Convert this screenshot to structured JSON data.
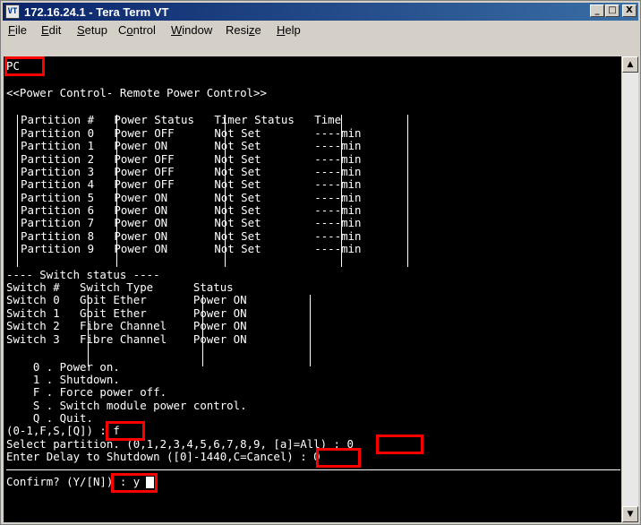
{
  "window": {
    "icon_label": "VT",
    "title": "172.16.24.1 - Tera Term VT",
    "controls": {
      "minimize": "_",
      "maximize": "□",
      "close": "X"
    }
  },
  "menu": [
    "File",
    "Edit",
    "Setup",
    "Control",
    "Window",
    "Resize",
    "Help"
  ],
  "menu_underline": [
    "F",
    "E",
    "S",
    "o",
    "W",
    "z",
    "H"
  ],
  "terminal": {
    "lines": [
      "PC",
      "<<Power Control- Remote Power Control>>",
      "Partition #   Power Status   Timer Status   Time",
      "Partition 0   Power OFF      Not Set        ----min",
      "Partition 1   Power ON       Not Set        ----min",
      "Partition 2   Power OFF      Not Set        ----min",
      "Partition 3   Power OFF      Not Set        ----min",
      "Partition 4   Power OFF      Not Set        ----min",
      "Partition 5   Power ON       Not Set        ----min",
      "Partition 6   Power ON       Not Set        ----min",
      "Partition 7   Power ON       Not Set        ----min",
      "Partition 8   Power ON       Not Set        ----min",
      "Partition 9   Power ON       Not Set        ----min",
      "---- Switch status ----",
      "Switch #   Switch Type      Status",
      "Switch 0   Gbit Ether       Power ON",
      "Switch 1   Gbit Ether       Power ON",
      "Switch 2   Fibre Channel    Power ON",
      "Switch 3   Fibre Channel    Power ON",
      "    0 . Power on.",
      "    1 . Shutdown.",
      "    F . Force power off.",
      "    S . Switch module power control.",
      "    Q . Quit.",
      "(0-1,F,S,[Q]) : f",
      "Select partition. (0,1,2,3,4,5,6,7,8,9, [a]=All) : 0",
      "Enter Delay to Shutdown ([0]-1440,C=Cancel) : 0",
      "Confirm? (Y/[N]) : y"
    ]
  },
  "scrollbar": {
    "up": "▲",
    "down": "▼"
  }
}
